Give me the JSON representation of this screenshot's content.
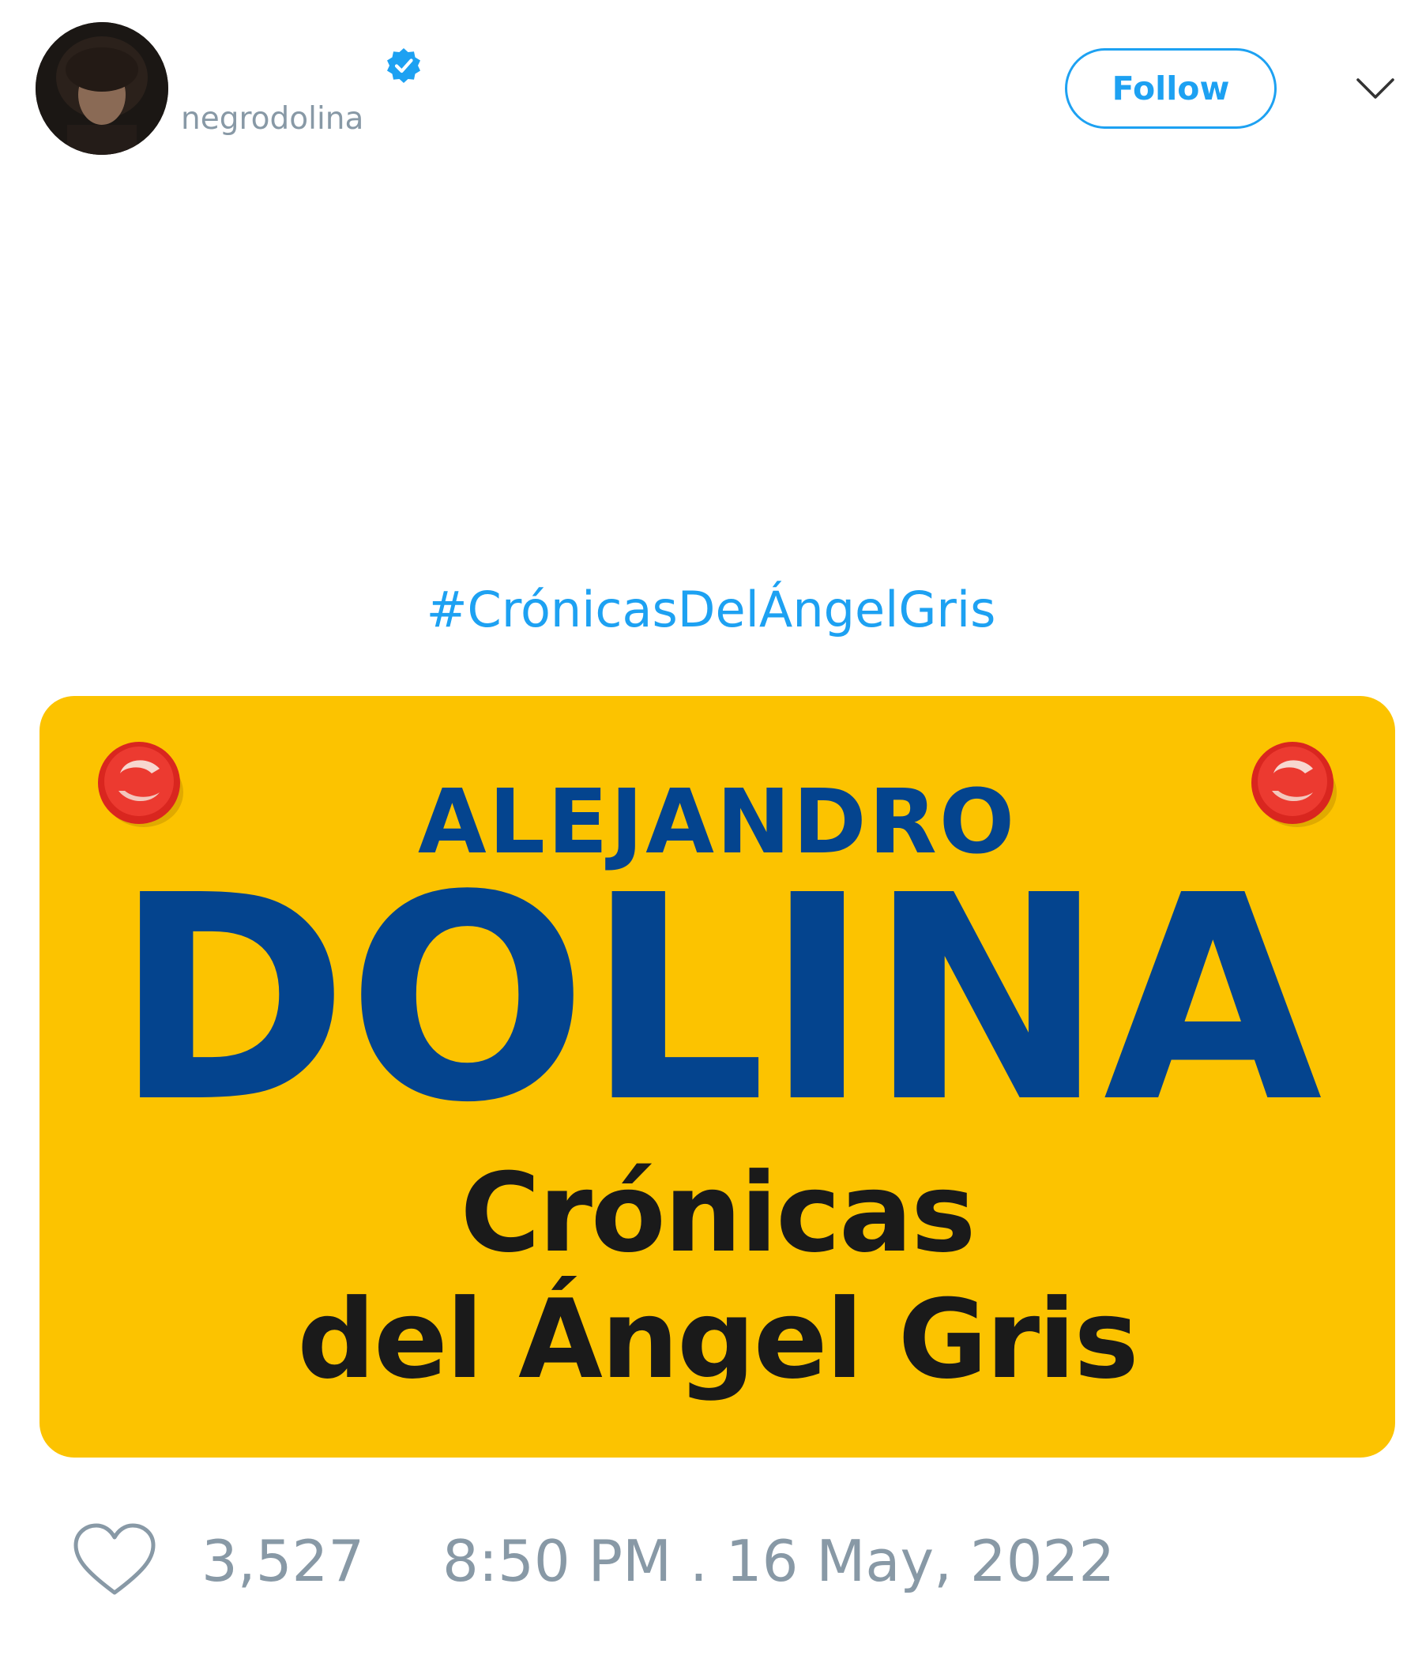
{
  "header": {
    "display_name": "",
    "handle": "negrodolina",
    "verified_icon": "verified-badge-icon",
    "follow_label": "Follow",
    "menu_icon": "chevron-down-icon"
  },
  "tweet": {
    "hashtag": "#CrónicasDelÁngelGris",
    "media": {
      "author_first": "ALEJANDRO",
      "author_last": "DOLINA",
      "title_line1": "Crónicas",
      "title_line2": "del Ángel Gris"
    }
  },
  "footer": {
    "like_icon": "heart-icon",
    "like_count": "3,527",
    "timestamp": "8:50 PM . 16 May, 2022"
  },
  "colors": {
    "accent": "#1da1f2",
    "muted_text": "#8899a6",
    "cover_yellow": "#fcc300",
    "cover_blue": "#04448e",
    "cover_dark": "#1a1a1a",
    "tack_red": "#e0302a"
  }
}
